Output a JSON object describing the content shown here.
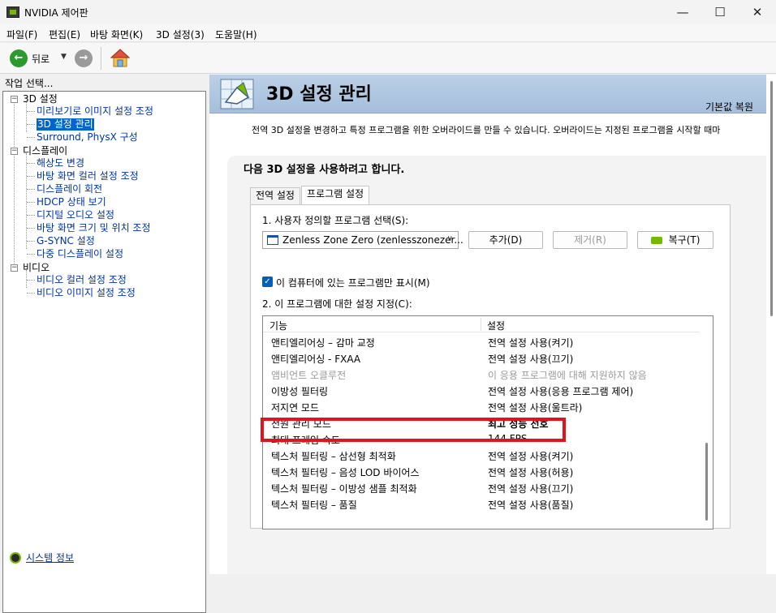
{
  "window": {
    "title": "NVIDIA 제어판"
  },
  "menu": [
    "파일(F)",
    "편집(E)",
    "바탕 화면(K)",
    "3D 설정(3)",
    "도움말(H)"
  ],
  "toolbar": {
    "back_label": "뒤로"
  },
  "left": {
    "task_label": "작업 선택...",
    "tree": {
      "g1": "3D 설정",
      "g1a": "미리보기로 이미지 설정 조정",
      "g1b": "3D 설정 관리",
      "g1c": "Surround, PhysX 구성",
      "g2": "디스플레이",
      "g2a": "해상도 변경",
      "g2b": "바탕 화면 컬러 설정 조정",
      "g2c": "디스플레이 회전",
      "g2d": "HDCP 상태 보기",
      "g2e": "디지털 오디오 설정",
      "g2f": "바탕 화면 크기 및 위치 조정",
      "g2g": "G-SYNC 설정",
      "g2h": "다중 디스플레이 설정",
      "g3": "비디오",
      "g3a": "비디오 컬러 설정 조정",
      "g3b": "비디오 이미지 설정 조정"
    },
    "system_info": "시스템 정보"
  },
  "content": {
    "title": "3D 설정 관리",
    "restore_defaults": "기본값 복원",
    "description": "전역 3D 설정을 변경하고 특정 프로그램을 위한 오버라이드를 만들 수 있습니다. 오버라이드는 지정된 프로그램을 시작할 때마",
    "heading": "다음 3D 설정을 사용하려고 합니다.",
    "tabs": [
      "전역 설정",
      "프로그램 설정"
    ],
    "step1": "1. 사용자 정의할 프로그램 선택(S):",
    "program_selected": "Zenless Zone Zero (zenlesszonezer...",
    "add_button": "추가(D)",
    "remove_button": "제거(R)",
    "restore_button": "복구(T)",
    "checkbox_label": "이 컴퓨터에 있는 프로그램만 표시(M)",
    "step2": "2. 이 프로그램에 대한 설정 지정(C):",
    "columns": {
      "feature": "기능",
      "setting": "설정"
    },
    "rows": [
      {
        "feature": "앤티엘리어싱 – 감마 교정",
        "setting": "전역 설정 사용(켜기)"
      },
      {
        "feature": "앤티엘리어싱 - FXAA",
        "setting": "전역 설정 사용(끄기)"
      },
      {
        "feature": "앰비언트 오클루전",
        "setting": "이 응용 프로그램에 대해 지원하지 않음"
      },
      {
        "feature": "이방성 필터링",
        "setting": "전역 설정 사용(응용 프로그램 제어)"
      },
      {
        "feature": "저지연 모드",
        "setting": "전역 설정 사용(울트라)"
      },
      {
        "feature": "전원 관리 모드",
        "setting": "최고 성능 선호"
      },
      {
        "feature": "최대 프레임 속도",
        "setting": "144 FPS"
      },
      {
        "feature": "텍스처 필터링 – 삼선형 최적화",
        "setting": "전역 설정 사용(켜기)"
      },
      {
        "feature": "텍스처 필터링 – 음성 LOD 바이어스",
        "setting": "전역 설정 사용(허용)"
      },
      {
        "feature": "텍스처 필터링 – 이방성 샘플 최적화",
        "setting": "전역 설정 사용(끄기)"
      },
      {
        "feature": "텍스처 필터링 – 품질",
        "setting": "전역 설정 사용(품질)"
      }
    ]
  },
  "colors": {
    "nvidia_green": "#76b900",
    "highlight_red": "#e0141e",
    "selection_blue": "#0066cc",
    "link_blue": "#0033aa"
  }
}
